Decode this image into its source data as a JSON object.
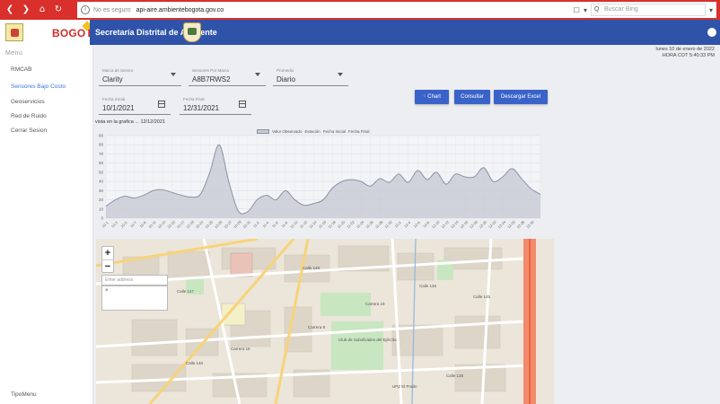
{
  "browser": {
    "insecure_label": "No es seguro",
    "url": "api-aire.ambientebogota.gov.co",
    "search_placeholder": "Buscar Bing"
  },
  "header": {
    "city_logo_text": "BOGOTÁ",
    "entity_name": "Secretaría Distrital de Ambiente"
  },
  "sidebar": {
    "title": "Menu",
    "items": [
      {
        "label": "RMCAB"
      },
      {
        "label": "Sensores Bajo Costo"
      },
      {
        "label": "Geoservicios"
      },
      {
        "label": "Red de Ruido"
      },
      {
        "label": "Cerrar Sesion"
      }
    ],
    "footer": "TipoMenu"
  },
  "datetime": {
    "line1": "lunes 10 de enero de 2022",
    "line2": "HORA COT 5:40:33 PM"
  },
  "filters": {
    "brand": {
      "label": "Marca de Sensor",
      "value": "Clarity"
    },
    "sensor": {
      "label": "Sensores Por Marca",
      "value": "A8B7RWS2"
    },
    "average": {
      "label": "Promedio",
      "value": "Diario"
    },
    "start_date": {
      "label": "Fecha Inicial",
      "value": "10/1/2021"
    },
    "end_date": {
      "label": "Fecha Final",
      "value": "12/31/2021"
    }
  },
  "buttons": {
    "chart": "Chart",
    "consult": "Consultar",
    "excel": "Descargar Excel"
  },
  "chart_header": "vista en la grafica ... 12/12/2021",
  "map": {
    "search_placeholder": "Enter address",
    "zoom_in": "+",
    "zoom_out": "−",
    "labels": [
      "Calle 148",
      "Calle 147",
      "Calle 146",
      "Calle 145",
      "Calle 140",
      "Calle 138",
      "Carrera 9",
      "Carrera 15",
      "Carrera 19",
      "Club de Suboficiales del Ejército",
      "UPZ El Prado"
    ]
  },
  "colors": {
    "brand_red": "#d12e2e",
    "header_blue": "#2f53a9",
    "button_blue": "#3a63c9",
    "active_link": "#3a78d4"
  },
  "chart_data": {
    "type": "area",
    "title": "",
    "legend": [
      "Valor Observado",
      "Estación",
      "Fecha Inicial",
      "Fecha Final"
    ],
    "ylim": [
      0,
      90
    ],
    "yticks": [
      0,
      10,
      20,
      30,
      40,
      50,
      60,
      70,
      80,
      90
    ],
    "x": [
      "10-1",
      "10-3",
      "10-5",
      "10-7",
      "10-9",
      "10-11",
      "10-13",
      "10-15",
      "10-17",
      "10-19",
      "10-21",
      "10-23",
      "10-25",
      "10-27",
      "10-29",
      "10-31",
      "11-2",
      "11-4",
      "11-6",
      "11-8",
      "11-10",
      "11-12",
      "11-14",
      "11-16",
      "11-18",
      "11-20",
      "11-22",
      "11-24",
      "11-26",
      "11-28",
      "11-30",
      "12-2",
      "12-4",
      "12-6",
      "12-8",
      "12-10",
      "12-12",
      "12-14",
      "12-16",
      "12-18",
      "12-20",
      "12-22",
      "12-24",
      "12-26",
      "12-28",
      "12-30"
    ],
    "series": [
      {
        "name": "Valor Observado",
        "values": [
          13,
          20,
          24,
          22,
          25,
          30,
          31,
          28,
          25,
          23,
          26,
          50,
          80,
          40,
          8,
          7,
          20,
          25,
          20,
          30,
          20,
          14,
          16,
          20,
          33,
          40,
          42,
          40,
          35,
          43,
          39,
          48,
          39,
          52,
          42,
          50,
          37,
          48,
          45,
          45,
          55,
          40,
          45,
          54,
          43,
          32,
          26
        ]
      }
    ]
  }
}
